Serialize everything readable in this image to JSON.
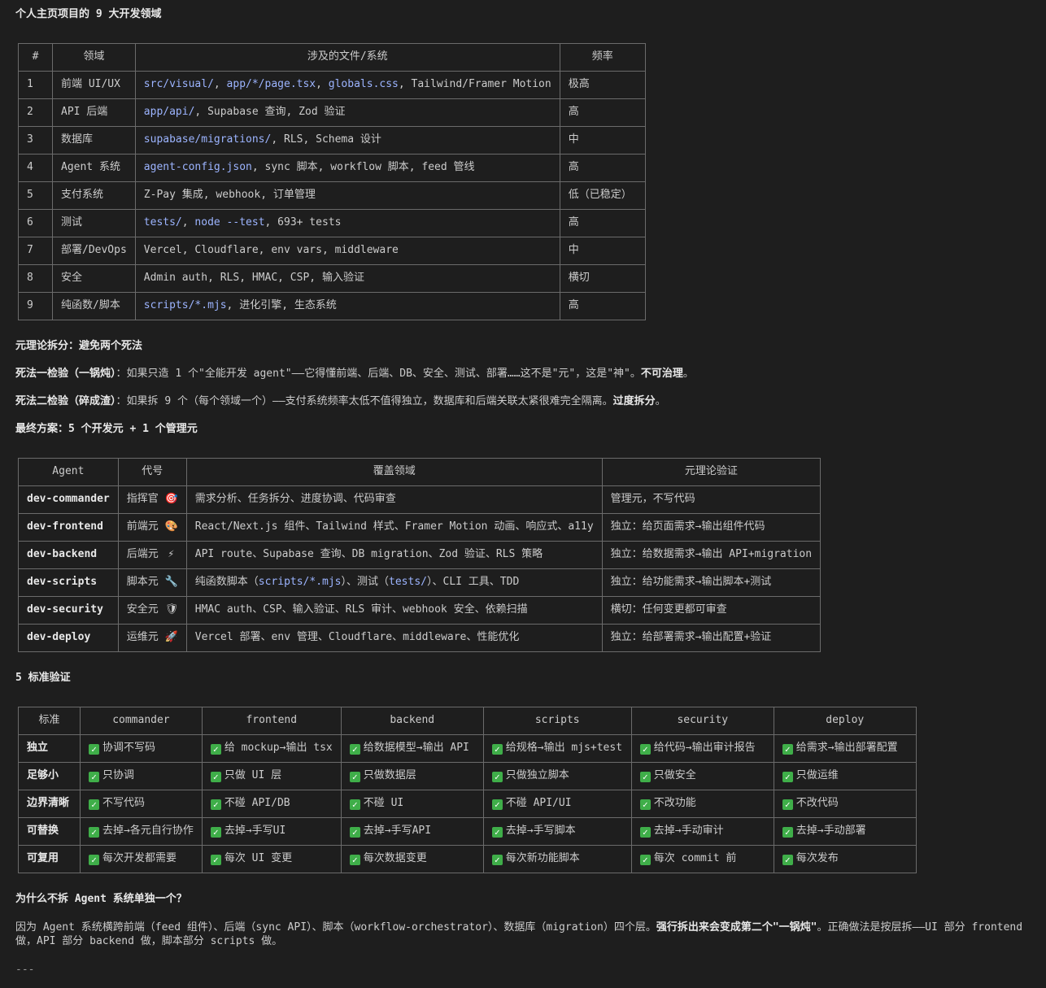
{
  "title1": "个人主页项目的 9 大开发领域",
  "domains_table": {
    "headers": [
      "#",
      "领域",
      "涉及的文件/系统",
      "频率"
    ],
    "rows": [
      {
        "n": "1",
        "area": "前端 UI/UX",
        "files_code": [
          "src/visual/",
          "app/*/page.tsx",
          "globals.css"
        ],
        "files_rest": ", Tailwind/Framer Motion",
        "freq": "极高"
      },
      {
        "n": "2",
        "area": "API 后端",
        "files_code": [
          "app/api/"
        ],
        "files_rest": ", Supabase 查询, Zod 验证",
        "freq": "高"
      },
      {
        "n": "3",
        "area": "数据库",
        "files_code": [
          "supabase/migrations/"
        ],
        "files_rest": ", RLS, Schema 设计",
        "freq": "中"
      },
      {
        "n": "4",
        "area": "Agent 系统",
        "files_code": [
          "agent-config.json"
        ],
        "files_rest": ", sync 脚本, workflow 脚本, feed 管线",
        "freq": "高"
      },
      {
        "n": "5",
        "area": "支付系统",
        "files_code": [],
        "files_rest": "Z-Pay 集成, webhook, 订单管理",
        "freq": "低（已稳定）"
      },
      {
        "n": "6",
        "area": "测试",
        "files_code": [
          "tests/",
          "node --test"
        ],
        "files_rest": ", 693+ tests",
        "freq": "高"
      },
      {
        "n": "7",
        "area": "部署/DevOps",
        "files_code": [],
        "files_rest": "Vercel, Cloudflare, env vars, middleware",
        "freq": "中"
      },
      {
        "n": "8",
        "area": "安全",
        "files_code": [],
        "files_rest": "Admin auth, RLS, HMAC, CSP, 输入验证",
        "freq": "横切"
      },
      {
        "n": "9",
        "area": "纯函数/脚本",
        "files_code": [
          "scripts/*.mjs"
        ],
        "files_rest": ", 进化引擎, 生态系统",
        "freq": "高"
      }
    ]
  },
  "title2": "元理论拆分：避免两个死法",
  "death1": {
    "label": "死法一检验（一锅炖）",
    "text": "：如果只造 1 个\"全能开发 agent\"——它得懂前端、后端、DB、安全、测试、部署……这不是\"元\"，这是\"神\"。",
    "strong": "不可治理",
    "end": "。"
  },
  "death2": {
    "label": "死法二检验（碎成渣）",
    "text": "：如果拆 9 个（每个领域一个）——支付系统频率太低不值得独立，数据库和后端关联太紧很难完全隔离。",
    "strong": "过度拆分",
    "end": "。"
  },
  "title3": "最终方案：5 个开发元 + 1 个管理元",
  "agents_table": {
    "headers": [
      "Agent",
      "代号",
      "覆盖领域",
      "元理论验证"
    ],
    "rows": [
      {
        "agent": "dev-commander",
        "code": "指挥官",
        "icon": "🎯",
        "scope": "需求分析、任务拆分、进度协调、代码审查",
        "verify": "管理元，不写代码"
      },
      {
        "agent": "dev-frontend",
        "code": "前端元",
        "icon": "🎨",
        "scope": "React/Next.js 组件、Tailwind 样式、Framer Motion 动画、响应式、a11y",
        "verify": "独立：给页面需求→输出组件代码"
      },
      {
        "agent": "dev-backend",
        "code": "后端元",
        "icon": "⚡",
        "scope": "API route、Supabase 查询、DB migration、Zod 验证、RLS 策略",
        "verify": "独立：给数据需求→输出 API+migration"
      },
      {
        "agent": "dev-scripts",
        "code": "脚本元",
        "icon": "🔧",
        "scope_pre": "纯函数脚本（",
        "scope_c1": "scripts/*.mjs",
        "scope_mid": "）、测试（",
        "scope_c2": "tests/",
        "scope_post": "）、CLI 工具、TDD",
        "verify": "独立：给功能需求→输出脚本+测试"
      },
      {
        "agent": "dev-security",
        "code": "安全元",
        "icon": "🛡",
        "scope": "HMAC auth、CSP、输入验证、RLS 审计、webhook 安全、依赖扫描",
        "verify": "横切：任何变更都可审查"
      },
      {
        "agent": "dev-deploy",
        "code": "运维元",
        "icon": "🚀",
        "scope": "Vercel 部署、env 管理、Cloudflare、middleware、性能优化",
        "verify": "独立：给部署需求→输出配置+验证"
      }
    ]
  },
  "title4": "5 标准验证",
  "criteria_table": {
    "headers": [
      "标准",
      "commander",
      "frontend",
      "backend",
      "scripts",
      "security",
      "deploy"
    ],
    "rows": [
      {
        "c": "独立",
        "v": [
          "协调不写码",
          "给 mockup→输出 tsx",
          "给数据模型→输出 API",
          "给规格→输出 mjs+test",
          "给代码→输出审计报告",
          "给需求→输出部署配置"
        ]
      },
      {
        "c": "足够小",
        "v": [
          "只协调",
          "只做 UI 层",
          "只做数据层",
          "只做独立脚本",
          "只做安全",
          "只做运维"
        ]
      },
      {
        "c": "边界清晰",
        "v": [
          "不写代码",
          "不碰 API/DB",
          "不碰 UI",
          "不碰 API/UI",
          "不改功能",
          "不改代码"
        ]
      },
      {
        "c": "可替换",
        "v": [
          "去掉→各元自行协作",
          "去掉→手写UI",
          "去掉→手写API",
          "去掉→手写脚本",
          "去掉→手动审计",
          "去掉→手动部署"
        ]
      },
      {
        "c": "可复用",
        "v": [
          "每次开发都需要",
          "每次 UI 变更",
          "每次数据变更",
          "每次新功能脚本",
          "每次 commit 前",
          "每次发布"
        ]
      }
    ]
  },
  "title5": "为什么不拆 Agent 系统单独一个？",
  "why": {
    "pre": "因为 Agent 系统横跨前端（feed 组件）、后端（sync API）、脚本（workflow-orchestrator）、数据库（migration）四个层。",
    "strong": "强行拆出来会变成第二个\"一锅炖\"",
    "post": "。正确做法是按层拆——UI 部分 frontend 做，API 部分 backend 做，脚本部分 scripts 做。"
  },
  "hr": "---",
  "colors": {
    "bg": "#1e1e1e",
    "text": "#cccccc",
    "code": "#9cb4ff",
    "border": "#6b6b6b",
    "check": "#3fae49"
  }
}
